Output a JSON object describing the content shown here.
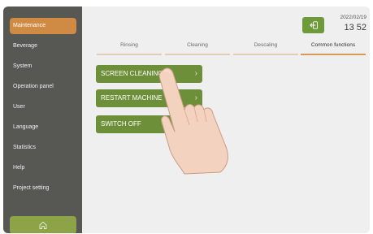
{
  "sidebar": {
    "items": [
      {
        "label": "Maintenance",
        "active": true
      },
      {
        "label": "Beverage"
      },
      {
        "label": "System"
      },
      {
        "label": "Operation panel"
      },
      {
        "label": "User"
      },
      {
        "label": "Language"
      },
      {
        "label": "Statistics"
      },
      {
        "label": "Help"
      },
      {
        "label": "Project setting"
      }
    ],
    "home_icon": "home-icon"
  },
  "header": {
    "date": "2022/02/19",
    "time": "13 52",
    "logout_icon": "logout-icon"
  },
  "tabs": [
    {
      "label": "Rinsing"
    },
    {
      "label": "Cleaning"
    },
    {
      "label": "Descaling"
    },
    {
      "label": "Common functions",
      "active": true
    }
  ],
  "functions": [
    {
      "label": "SCREEN CLEANING"
    },
    {
      "label": "RESTART MACHINE"
    },
    {
      "label": "SWITCH OFF"
    }
  ],
  "colors": {
    "sidebar": "#575754",
    "accent_orange": "#cf8a43",
    "accent_green": "#6e8f3a",
    "background": "#efefef"
  }
}
